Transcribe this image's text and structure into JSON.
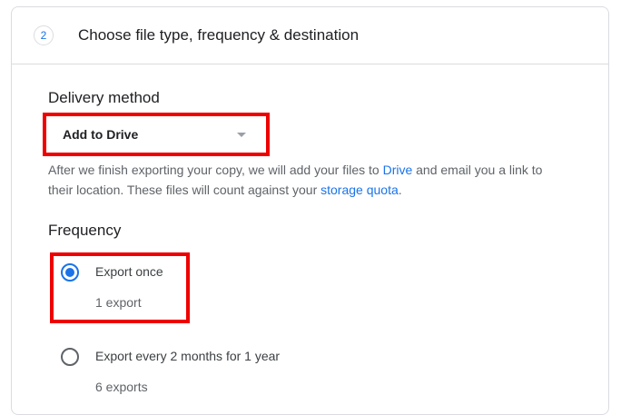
{
  "step": {
    "number": "2",
    "title": "Choose file type, frequency & destination"
  },
  "delivery": {
    "label": "Delivery method",
    "selected": "Add to Drive",
    "description": {
      "part1": "After we finish exporting your copy, we will add your files to ",
      "link1": "Drive",
      "part2": " and email you a link to their location. These files will count against your ",
      "link2": "storage quota",
      "part3": "."
    }
  },
  "frequency": {
    "label": "Frequency",
    "options": [
      {
        "label": "Export once",
        "sublabel": "1 export",
        "checked": true
      },
      {
        "label": "Export every 2 months for 1 year",
        "sublabel": "6 exports",
        "checked": false
      }
    ]
  },
  "colors": {
    "accent": "#1a73e8",
    "highlight": "#ee0000",
    "border": "#dadce0"
  }
}
